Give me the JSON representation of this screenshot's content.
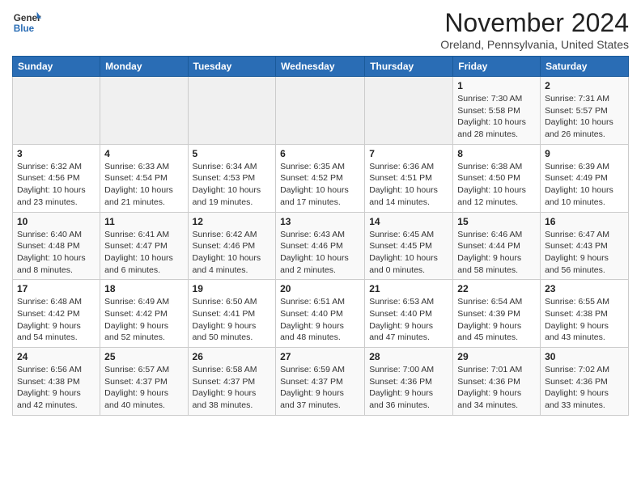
{
  "logo": {
    "line1": "General",
    "line2": "Blue"
  },
  "title": "November 2024",
  "location": "Oreland, Pennsylvania, United States",
  "days_header": [
    "Sunday",
    "Monday",
    "Tuesday",
    "Wednesday",
    "Thursday",
    "Friday",
    "Saturday"
  ],
  "weeks": [
    [
      {
        "day": "",
        "info": ""
      },
      {
        "day": "",
        "info": ""
      },
      {
        "day": "",
        "info": ""
      },
      {
        "day": "",
        "info": ""
      },
      {
        "day": "",
        "info": ""
      },
      {
        "day": "1",
        "info": "Sunrise: 7:30 AM\nSunset: 5:58 PM\nDaylight: 10 hours and 28 minutes."
      },
      {
        "day": "2",
        "info": "Sunrise: 7:31 AM\nSunset: 5:57 PM\nDaylight: 10 hours and 26 minutes."
      }
    ],
    [
      {
        "day": "3",
        "info": "Sunrise: 6:32 AM\nSunset: 4:56 PM\nDaylight: 10 hours and 23 minutes."
      },
      {
        "day": "4",
        "info": "Sunrise: 6:33 AM\nSunset: 4:54 PM\nDaylight: 10 hours and 21 minutes."
      },
      {
        "day": "5",
        "info": "Sunrise: 6:34 AM\nSunset: 4:53 PM\nDaylight: 10 hours and 19 minutes."
      },
      {
        "day": "6",
        "info": "Sunrise: 6:35 AM\nSunset: 4:52 PM\nDaylight: 10 hours and 17 minutes."
      },
      {
        "day": "7",
        "info": "Sunrise: 6:36 AM\nSunset: 4:51 PM\nDaylight: 10 hours and 14 minutes."
      },
      {
        "day": "8",
        "info": "Sunrise: 6:38 AM\nSunset: 4:50 PM\nDaylight: 10 hours and 12 minutes."
      },
      {
        "day": "9",
        "info": "Sunrise: 6:39 AM\nSunset: 4:49 PM\nDaylight: 10 hours and 10 minutes."
      }
    ],
    [
      {
        "day": "10",
        "info": "Sunrise: 6:40 AM\nSunset: 4:48 PM\nDaylight: 10 hours and 8 minutes."
      },
      {
        "day": "11",
        "info": "Sunrise: 6:41 AM\nSunset: 4:47 PM\nDaylight: 10 hours and 6 minutes."
      },
      {
        "day": "12",
        "info": "Sunrise: 6:42 AM\nSunset: 4:46 PM\nDaylight: 10 hours and 4 minutes."
      },
      {
        "day": "13",
        "info": "Sunrise: 6:43 AM\nSunset: 4:46 PM\nDaylight: 10 hours and 2 minutes."
      },
      {
        "day": "14",
        "info": "Sunrise: 6:45 AM\nSunset: 4:45 PM\nDaylight: 10 hours and 0 minutes."
      },
      {
        "day": "15",
        "info": "Sunrise: 6:46 AM\nSunset: 4:44 PM\nDaylight: 9 hours and 58 minutes."
      },
      {
        "day": "16",
        "info": "Sunrise: 6:47 AM\nSunset: 4:43 PM\nDaylight: 9 hours and 56 minutes."
      }
    ],
    [
      {
        "day": "17",
        "info": "Sunrise: 6:48 AM\nSunset: 4:42 PM\nDaylight: 9 hours and 54 minutes."
      },
      {
        "day": "18",
        "info": "Sunrise: 6:49 AM\nSunset: 4:42 PM\nDaylight: 9 hours and 52 minutes."
      },
      {
        "day": "19",
        "info": "Sunrise: 6:50 AM\nSunset: 4:41 PM\nDaylight: 9 hours and 50 minutes."
      },
      {
        "day": "20",
        "info": "Sunrise: 6:51 AM\nSunset: 4:40 PM\nDaylight: 9 hours and 48 minutes."
      },
      {
        "day": "21",
        "info": "Sunrise: 6:53 AM\nSunset: 4:40 PM\nDaylight: 9 hours and 47 minutes."
      },
      {
        "day": "22",
        "info": "Sunrise: 6:54 AM\nSunset: 4:39 PM\nDaylight: 9 hours and 45 minutes."
      },
      {
        "day": "23",
        "info": "Sunrise: 6:55 AM\nSunset: 4:38 PM\nDaylight: 9 hours and 43 minutes."
      }
    ],
    [
      {
        "day": "24",
        "info": "Sunrise: 6:56 AM\nSunset: 4:38 PM\nDaylight: 9 hours and 42 minutes."
      },
      {
        "day": "25",
        "info": "Sunrise: 6:57 AM\nSunset: 4:37 PM\nDaylight: 9 hours and 40 minutes."
      },
      {
        "day": "26",
        "info": "Sunrise: 6:58 AM\nSunset: 4:37 PM\nDaylight: 9 hours and 38 minutes."
      },
      {
        "day": "27",
        "info": "Sunrise: 6:59 AM\nSunset: 4:37 PM\nDaylight: 9 hours and 37 minutes."
      },
      {
        "day": "28",
        "info": "Sunrise: 7:00 AM\nSunset: 4:36 PM\nDaylight: 9 hours and 36 minutes."
      },
      {
        "day": "29",
        "info": "Sunrise: 7:01 AM\nSunset: 4:36 PM\nDaylight: 9 hours and 34 minutes."
      },
      {
        "day": "30",
        "info": "Sunrise: 7:02 AM\nSunset: 4:36 PM\nDaylight: 9 hours and 33 minutes."
      }
    ]
  ]
}
